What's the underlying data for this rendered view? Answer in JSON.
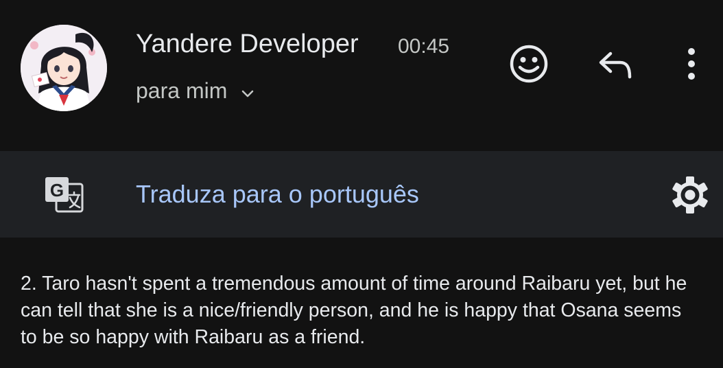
{
  "header": {
    "sender_name": "Yandere Developer",
    "time": "00:45",
    "recipient": "para mim",
    "avatar_icon": "avatar-anime-girl",
    "recipient_chevron_icon": "chevron-down-icon",
    "emoji_icon": "smiley-face-icon",
    "reply_icon": "reply-arrow-icon",
    "more_icon": "more-vert-icon"
  },
  "translate_bar": {
    "icon": "google-translate-icon",
    "link_label": "Traduza para o português",
    "settings_icon": "gear-icon"
  },
  "message": {
    "body": "2. Taro hasn't spent a tremendous amount of time around Raibaru yet, but he can tell that she is a nice/friendly person, and he is happy that Osana seems to be so happy with Raibaru as a friend."
  },
  "colors": {
    "background": "#121212",
    "translate_bar_background": "#1f2124",
    "link": "#a8c7fa",
    "text_primary": "#e8eaed",
    "text_secondary": "#c4c7c5"
  }
}
